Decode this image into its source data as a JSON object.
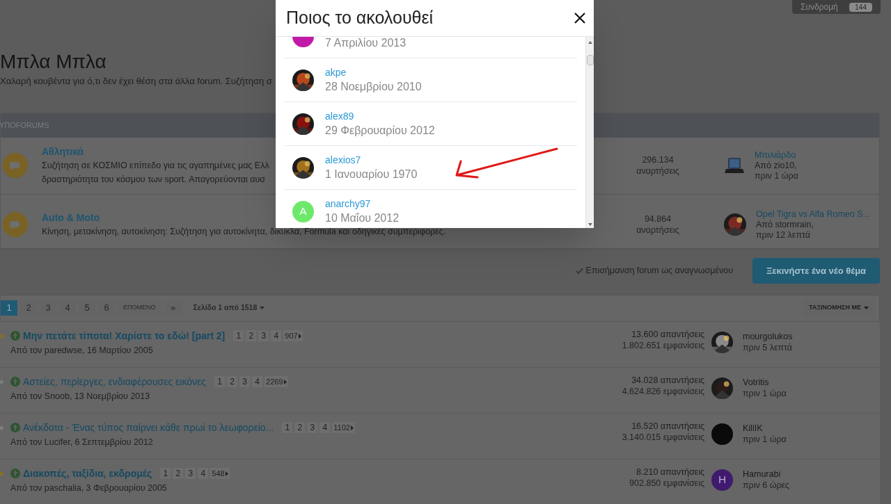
{
  "subscribe": {
    "label": "Συνδρομή",
    "count": "144"
  },
  "forum": {
    "title": "Μπλα Μπλα",
    "description": "Χαλαρή κουβέντα για ό,τι δεν έχει θέση στα άλλα forum. Συζήτηση σ"
  },
  "subforums": {
    "heading": "ΥΠΟFORUMS",
    "rows": [
      {
        "title": "Αθλητικά",
        "description": [
          "Συζήτηση σε ΚΟΣΜΙΟ επίπεδο για τις αγαπημένες μας Ελλ",
          "δραστηριότητα του κόσμου των sport. Απαγορεύονται αυσ"
        ],
        "posts": "296.134",
        "posts_label": "αναρτήσεις",
        "last_post": {
          "avatar": {
            "kind": "laptop"
          },
          "title": "Μπιλιάρδο",
          "by": "Από zio10,",
          "time": "πριν 1 ώρα"
        }
      },
      {
        "title": "Auto & Moto",
        "description": [
          "Κίνηση, μετακίνηση, αυτοκίνηση: Συζήτηση για αυτοκίνητα, δίκυκλα, Formula και οδηγικές συμπεριφορές."
        ],
        "posts": "94.864",
        "posts_label": "αναρτήσεις",
        "last_post": {
          "title": "Opel Tigra vs Alfa Romeo S...",
          "by": "Από stormrain,",
          "time": "πριν 12 λεπτά"
        }
      }
    ]
  },
  "actions": {
    "mark_read": "Επισήμανση forum ως αναγνωσμένου",
    "new_topic": "Ξεκινήστε ένα νέο θέμα"
  },
  "pagination": {
    "pages": [
      {
        "label": "1",
        "selected": true
      },
      {
        "label": "2",
        "selected": false
      },
      {
        "label": "3",
        "selected": false
      },
      {
        "label": "4",
        "selected": false
      },
      {
        "label": "5",
        "selected": false
      },
      {
        "label": "6",
        "selected": false
      }
    ],
    "next": "ΕΠΟΜΕΝΟ",
    "last": "»",
    "page_info": "Σελίδα 1 από 1518",
    "sort": "ΤΑΞΙΝΟΜΗΣΗ ΜΕ"
  },
  "topics": [
    {
      "starred": true,
      "title": "Μην πετάτε τίποτα! Χαρίστε το εδώ! [part 2]",
      "bold": true,
      "pages": [
        "1",
        "2",
        "3",
        "4"
      ],
      "last_page": "907",
      "byline": "Από τον paredwse, 16 Μαρτίου 2005",
      "replies": "13.600 απαντήσεις",
      "views": "1.802.651 εμφανίσεις",
      "poster": {
        "name": "mourgolukos",
        "time": "πριν 5 λεπτά"
      }
    },
    {
      "starred": false,
      "title": "Αστείες, περίεργες, ενδιαφέρουσες εικόνες",
      "bold": false,
      "pages": [
        "1",
        "2",
        "3",
        "4"
      ],
      "last_page": "2269",
      "byline": "Από τον Snoob, 13 Νοεμβρίου 2013",
      "replies": "34.028 απαντήσεις",
      "views": "4.624.826 εμφανίσεις",
      "poster": {
        "name": "Votritis",
        "time": "πριν 1 ώρα"
      }
    },
    {
      "starred": false,
      "title": "Ανέκδοτα - Ένας τύπος παίρνει κάθε πρωί το λεωφορείο...",
      "bold": false,
      "pages": [
        "1",
        "2",
        "3",
        "4"
      ],
      "last_page": "1102",
      "byline": "Από τον Lucifer, 6 Σεπτεμβρίου 2012",
      "replies": "16.520 απαντήσεις",
      "views": "3.140.015 εμφανίσεις",
      "poster": {
        "avatar": {
          "kind": "plain",
          "color": "#0a0a0a"
        },
        "name": "KillIK",
        "time": "πριν 1 ώρα"
      }
    },
    {
      "starred": true,
      "title": "Διακοπές, ταξίδια, εκδρομές",
      "bold": true,
      "pages": [
        "1",
        "2",
        "3",
        "4"
      ],
      "last_page": "548",
      "byline": "Από τον paschalia, 3 Φεβρουαρίου 2005",
      "replies": "8.210 απαντήσεις",
      "views": "902.850 εμφανίσεις",
      "poster": {
        "avatar": {
          "kind": "letter",
          "letter": "H",
          "color": "#3f1a6e"
        },
        "name": "Hamurabi",
        "time": "πριν 6 ώρες"
      }
    }
  ],
  "modal": {
    "title": "Ποιος το ακολουθεί",
    "followers": [
      {
        "date": "7 Απριλίου 2013",
        "avatar": {
          "kind": "plain",
          "color": "#c21aa8"
        }
      },
      {
        "name": "akpe",
        "date": "28 Νοεμβρίου 2010"
      },
      {
        "name": "alex89",
        "date": "29 Φεβρουαρίου 2012"
      },
      {
        "name": "alexios7",
        "date": "1 Ιανουαρίου 1970"
      },
      {
        "name": "anarchy97",
        "date": "10 Μαΐου 2012",
        "avatar": {
          "kind": "letter",
          "letter": "A",
          "color": "#6ee86a"
        }
      }
    ]
  }
}
